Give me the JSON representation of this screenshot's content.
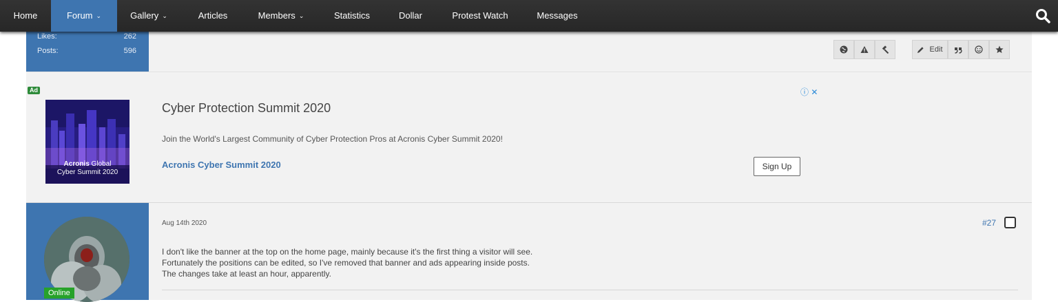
{
  "nav": {
    "items": [
      {
        "label": "Home"
      },
      {
        "label": "Forum",
        "chevron": "⌄"
      },
      {
        "label": "Gallery",
        "chevron": "⌄"
      },
      {
        "label": "Articles"
      },
      {
        "label": "Members",
        "chevron": "⌄"
      },
      {
        "label": "Statistics"
      },
      {
        "label": "Dollar"
      },
      {
        "label": "Protest Watch"
      },
      {
        "label": "Messages"
      }
    ],
    "active": "Forum",
    "search_icon": "search-icon"
  },
  "prev_post": {
    "stats": [
      {
        "label": "Likes:",
        "value": "262"
      },
      {
        "label": "Posts:",
        "value": "596"
      }
    ],
    "toolbar": {
      "edit_label": "Edit",
      "icons": [
        "globe-icon",
        "warning-icon",
        "gavel-icon",
        "pencil-icon",
        "quote-icon",
        "smiley-icon",
        "star-icon"
      ]
    }
  },
  "ad": {
    "badge": "Ad",
    "image_caption_brand": "Acronis",
    "image_caption_rest": " Global",
    "image_caption_line2": "Cyber Summit 2020",
    "title": "Cyber Protection Summit 2020",
    "description": "Join the World's Largest Community of Cyber Protection Pros at Acronis Cyber Summit 2020!",
    "link_text": "Acronis Cyber Summit 2020",
    "button_label": "Sign Up",
    "info_icon": "ⓘ",
    "close_icon": "✕"
  },
  "post": {
    "status": "Online",
    "date": "Aug 14th 2020",
    "number": "#27",
    "body": [
      "I don't like the banner at the top on the home page, mainly because it's the first thing a visitor will see.",
      "Fortunately the positions can be edited, so I've removed that banner and ads appearing inside posts.",
      "The changes take at least an hour, apparently."
    ]
  },
  "colors": {
    "nav_bg": "#2b2b2b",
    "accent": "#3e75b0",
    "online": "#27a22a",
    "ad_badge": "#2e8b3a"
  }
}
